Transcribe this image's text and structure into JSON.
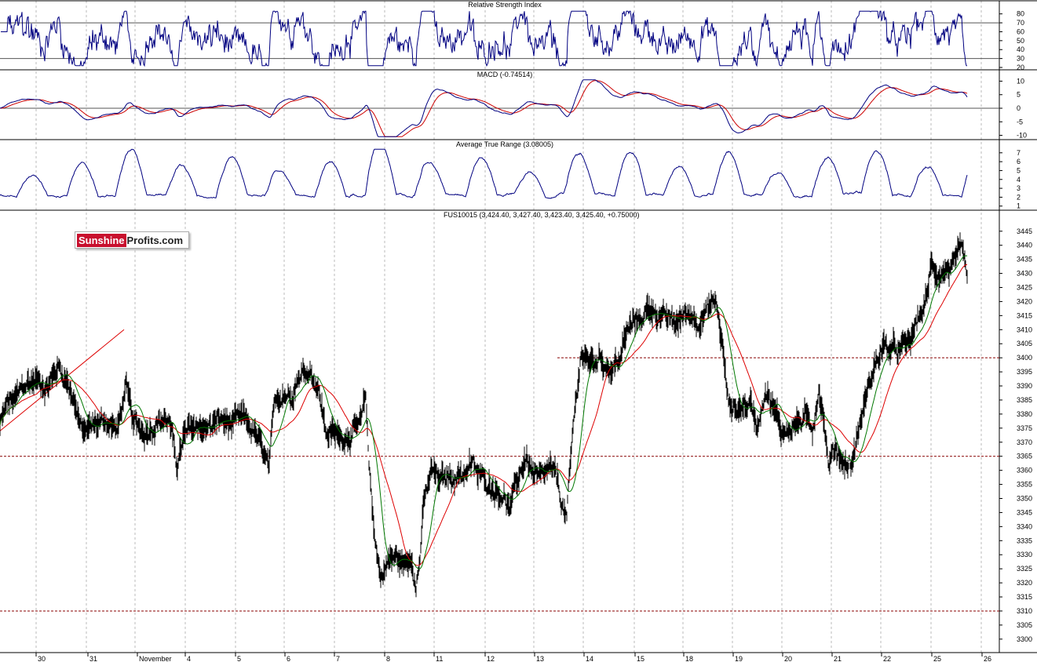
{
  "chart_data": [
    {
      "type": "line",
      "title": "Relative Strength Index",
      "yticks": [
        80,
        70,
        60,
        50,
        40,
        30,
        20
      ],
      "ylim": [
        20,
        85
      ],
      "reference_lines": [
        70,
        30
      ],
      "colors": {
        "line": "#000080"
      }
    },
    {
      "type": "line",
      "title": "MACD (-0.74514)",
      "yticks": [
        10,
        5,
        0,
        -5,
        -10
      ],
      "ylim": [
        -11,
        11
      ],
      "reference_lines": [
        0
      ],
      "series": [
        {
          "values_key": "macd",
          "color": "#000080"
        },
        {
          "values_key": "signal",
          "color": "#cc0000"
        }
      ]
    },
    {
      "type": "line",
      "title": "Average True Range (3.08005)",
      "yticks": [
        7,
        6,
        5,
        4,
        3,
        2,
        1
      ],
      "ylim": [
        0.8,
        7.6
      ],
      "colors": {
        "line": "#000080"
      }
    },
    {
      "type": "line",
      "title": "FUS10015 (3,424.40, 3,427.40, 3,423.40, 3,425.40, +0.75000)",
      "yticks": [
        3445,
        3440,
        3435,
        3430,
        3425,
        3420,
        3415,
        3410,
        3405,
        3400,
        3395,
        3390,
        3385,
        3380,
        3375,
        3370,
        3365,
        3360,
        3355,
        3350,
        3345,
        3340,
        3335,
        3330,
        3325,
        3320,
        3315,
        3310,
        3305,
        3300
      ],
      "ylim": [
        3298,
        3448
      ],
      "x_date_labels": [
        "30",
        "31",
        "November",
        "4",
        "5",
        "6",
        "7",
        "8",
        "11",
        "12",
        "13",
        "14",
        "15",
        "18",
        "19",
        "20",
        "21",
        "22",
        "25",
        "26"
      ],
      "price_anchors": [
        [
          0,
          3376
        ],
        [
          10,
          3384
        ],
        [
          20,
          3385
        ],
        [
          30,
          3390
        ],
        [
          45,
          3392
        ],
        [
          60,
          3390
        ],
        [
          75,
          3397
        ],
        [
          85,
          3392
        ],
        [
          95,
          3385
        ],
        [
          105,
          3373
        ],
        [
          120,
          3376
        ],
        [
          135,
          3378
        ],
        [
          150,
          3374
        ],
        [
          160,
          3390
        ],
        [
          170,
          3376
        ],
        [
          185,
          3374
        ],
        [
          200,
          3378
        ],
        [
          215,
          3378
        ],
        [
          225,
          3362
        ],
        [
          235,
          3372
        ],
        [
          250,
          3376
        ],
        [
          265,
          3375
        ],
        [
          280,
          3378
        ],
        [
          295,
          3376
        ],
        [
          310,
          3378
        ],
        [
          325,
          3373
        ],
        [
          335,
          3366
        ],
        [
          343,
          3360
        ],
        [
          350,
          3384
        ],
        [
          360,
          3388
        ],
        [
          370,
          3387
        ],
        [
          380,
          3394
        ],
        [
          395,
          3396
        ],
        [
          405,
          3390
        ],
        [
          415,
          3374
        ],
        [
          430,
          3372
        ],
        [
          445,
          3373
        ],
        [
          460,
          3376
        ],
        [
          466,
          3386
        ],
        [
          470,
          3362
        ],
        [
          478,
          3335
        ],
        [
          485,
          3322
        ],
        [
          495,
          3328
        ],
        [
          505,
          3329
        ],
        [
          515,
          3326
        ],
        [
          525,
          3330
        ],
        [
          530,
          3319
        ],
        [
          535,
          3330
        ],
        [
          540,
          3348
        ],
        [
          550,
          3360
        ],
        [
          560,
          3356
        ],
        [
          575,
          3358
        ],
        [
          590,
          3359
        ],
        [
          600,
          3362
        ],
        [
          610,
          3358
        ],
        [
          625,
          3355
        ],
        [
          640,
          3352
        ],
        [
          650,
          3346
        ],
        [
          660,
          3357
        ],
        [
          670,
          3365
        ],
        [
          680,
          3358
        ],
        [
          690,
          3356
        ],
        [
          700,
          3360
        ],
        [
          710,
          3356
        ],
        [
          716,
          3348
        ],
        [
          722,
          3343
        ],
        [
          730,
          3374
        ],
        [
          740,
          3402
        ],
        [
          750,
          3398
        ],
        [
          765,
          3400
        ],
        [
          780,
          3396
        ],
        [
          790,
          3400
        ],
        [
          800,
          3410
        ],
        [
          815,
          3414
        ],
        [
          830,
          3418
        ],
        [
          845,
          3414
        ],
        [
          860,
          3412
        ],
        [
          875,
          3416
        ],
        [
          890,
          3414
        ],
        [
          905,
          3418
        ],
        [
          912,
          3420
        ],
        [
          920,
          3405
        ],
        [
          928,
          3383
        ],
        [
          940,
          3382
        ],
        [
          955,
          3384
        ],
        [
          965,
          3376
        ],
        [
          975,
          3390
        ],
        [
          985,
          3382
        ],
        [
          995,
          3374
        ],
        [
          1010,
          3376
        ],
        [
          1025,
          3378
        ],
        [
          1035,
          3375
        ],
        [
          1043,
          3390
        ],
        [
          1050,
          3378
        ],
        [
          1055,
          3362
        ],
        [
          1065,
          3368
        ],
        [
          1075,
          3363
        ],
        [
          1085,
          3362
        ],
        [
          1095,
          3376
        ],
        [
          1105,
          3388
        ],
        [
          1115,
          3398
        ],
        [
          1125,
          3404
        ],
        [
          1140,
          3402
        ],
        [
          1150,
          3403
        ],
        [
          1160,
          3406
        ],
        [
          1170,
          3414
        ],
        [
          1180,
          3420
        ],
        [
          1186,
          3432
        ],
        [
          1195,
          3430
        ],
        [
          1210,
          3432
        ],
        [
          1225,
          3436
        ],
        [
          1229,
          3433
        ],
        [
          1232,
          3425
        ]
      ],
      "dashed_levels": [
        3400,
        3365,
        3310
      ],
      "trendline": {
        "from": [
          0,
          3374
        ],
        "to": [
          158,
          3410
        ]
      },
      "colors": {
        "price": "#000000",
        "ma_fast": "#007700",
        "ma_slow": "#dd0000",
        "levels": "#880000",
        "trendline": "#dd0000"
      }
    }
  ],
  "branding": {
    "part1": "Sunshine",
    "part2": "Profits.com"
  }
}
